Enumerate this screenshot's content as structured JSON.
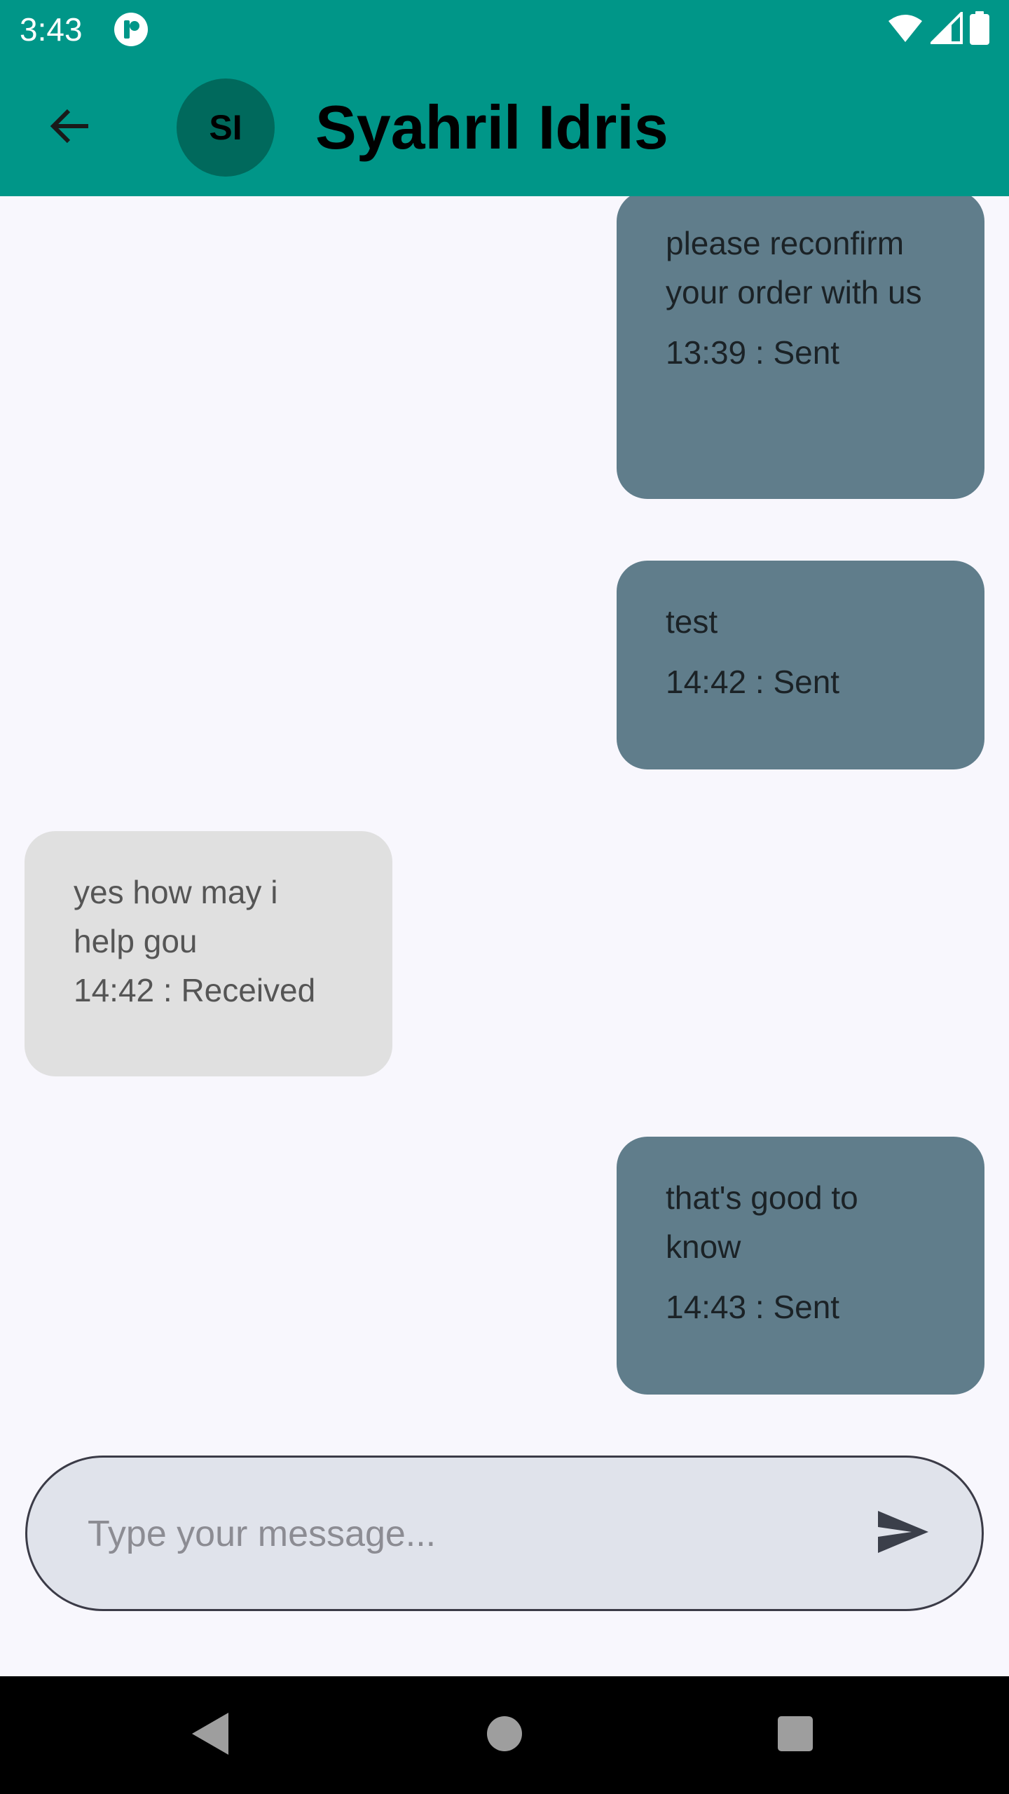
{
  "status_bar": {
    "time": "3:43",
    "icons": [
      "app-notification-icon",
      "wifi-icon",
      "cell-signal-icon",
      "battery-icon"
    ]
  },
  "app_bar": {
    "back_icon": "arrow-left-icon",
    "avatar_initials": "SI",
    "contact_name": "Syahril Idris",
    "background_color": "#009688",
    "avatar_color": "#00695c"
  },
  "messages": [
    {
      "direction": "sent",
      "text": "please reconfirm your order with us",
      "meta": "13:39 : Sent"
    },
    {
      "direction": "sent",
      "text": "test",
      "meta": "14:42 : Sent"
    },
    {
      "direction": "received",
      "text": "yes how may i help gou",
      "meta": "14:42  : Received"
    },
    {
      "direction": "sent",
      "text": "that's good to know",
      "meta": "14:43 : Sent"
    }
  ],
  "composer": {
    "placeholder": "Type your message...",
    "value": "",
    "send_icon": "send-icon"
  },
  "colors": {
    "sent_bubble": "#607d8b",
    "received_bubble": "#e0e0e0",
    "background": "#f8f7fd"
  },
  "nav_bar": {
    "buttons": [
      "back-triangle-icon",
      "home-circle-icon",
      "recents-square-icon"
    ]
  }
}
